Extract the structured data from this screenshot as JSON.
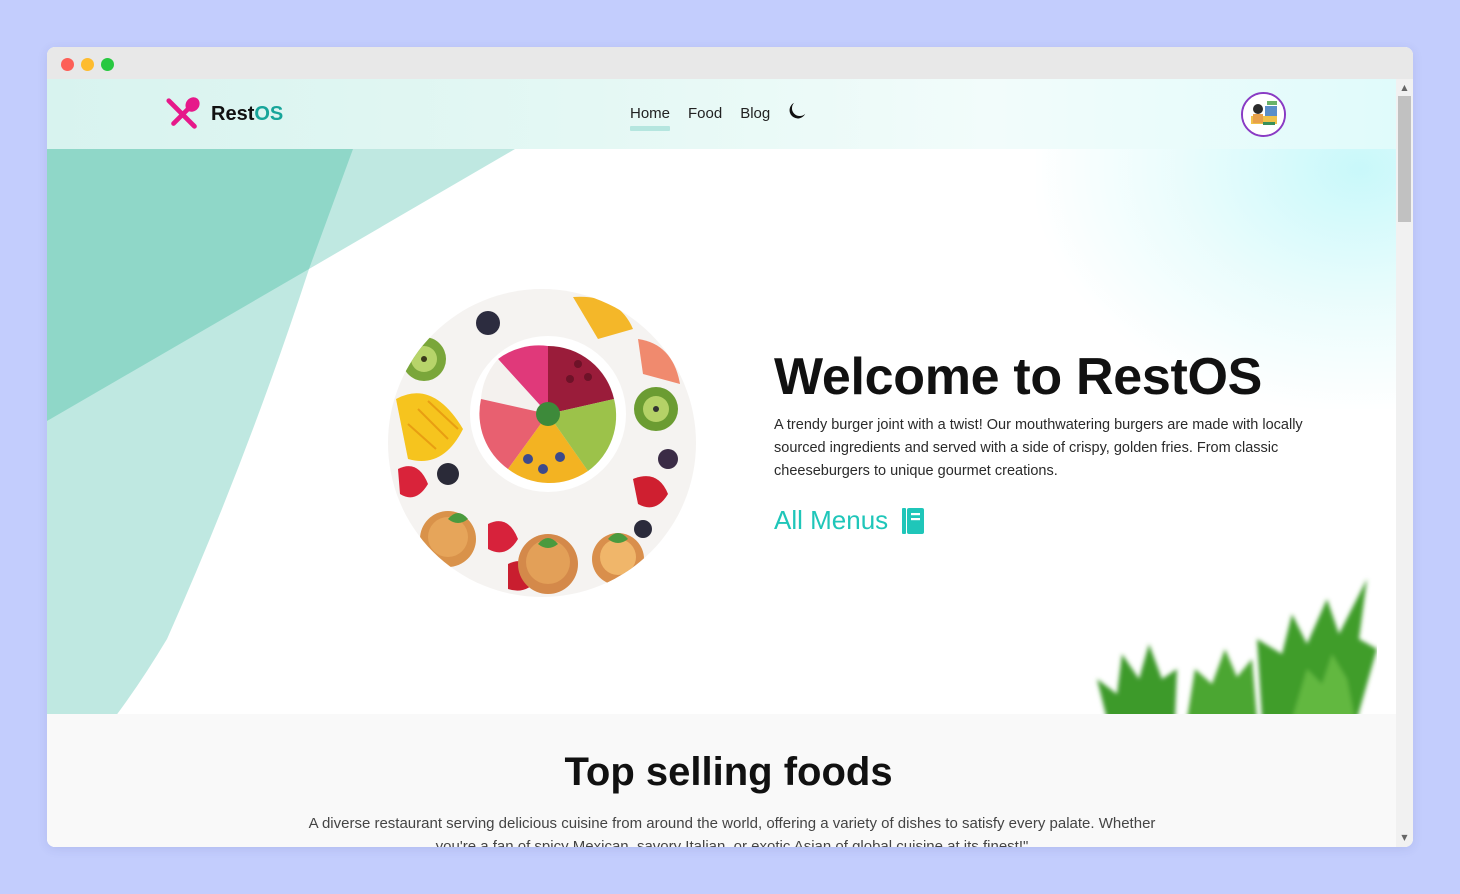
{
  "navbar": {
    "logo_text_main": "Rest",
    "logo_text_accent": "OS",
    "links": [
      {
        "label": "Home",
        "active": true
      },
      {
        "label": "Food",
        "active": false
      },
      {
        "label": "Blog",
        "active": false
      }
    ],
    "theme_icon": "moon-icon",
    "avatar_icon": "user-avatar"
  },
  "hero": {
    "title": "Welcome to RestOS",
    "description": "A trendy burger joint with a twist! Our mouthwatering burgers are made with locally sourced ingredients and served with a side of crispy, golden fries. From classic cheeseburgers to unique gourmet creations.",
    "cta_label": "All Menus",
    "cta_icon": "book-icon"
  },
  "top_selling": {
    "title": "Top selling foods",
    "description": "A diverse restaurant serving delicious cuisine from around the world, offering a variety of dishes to satisfy every palate. Whether you're a fan of spicy Mexican, savory Italian, or exotic Asian of global cuisine at its finest!\""
  },
  "colors": {
    "accent": "#1fc6b9",
    "brand_pink": "#e6198a",
    "brand_teal": "#17a59a",
    "page_background": "#c3cdfd"
  }
}
